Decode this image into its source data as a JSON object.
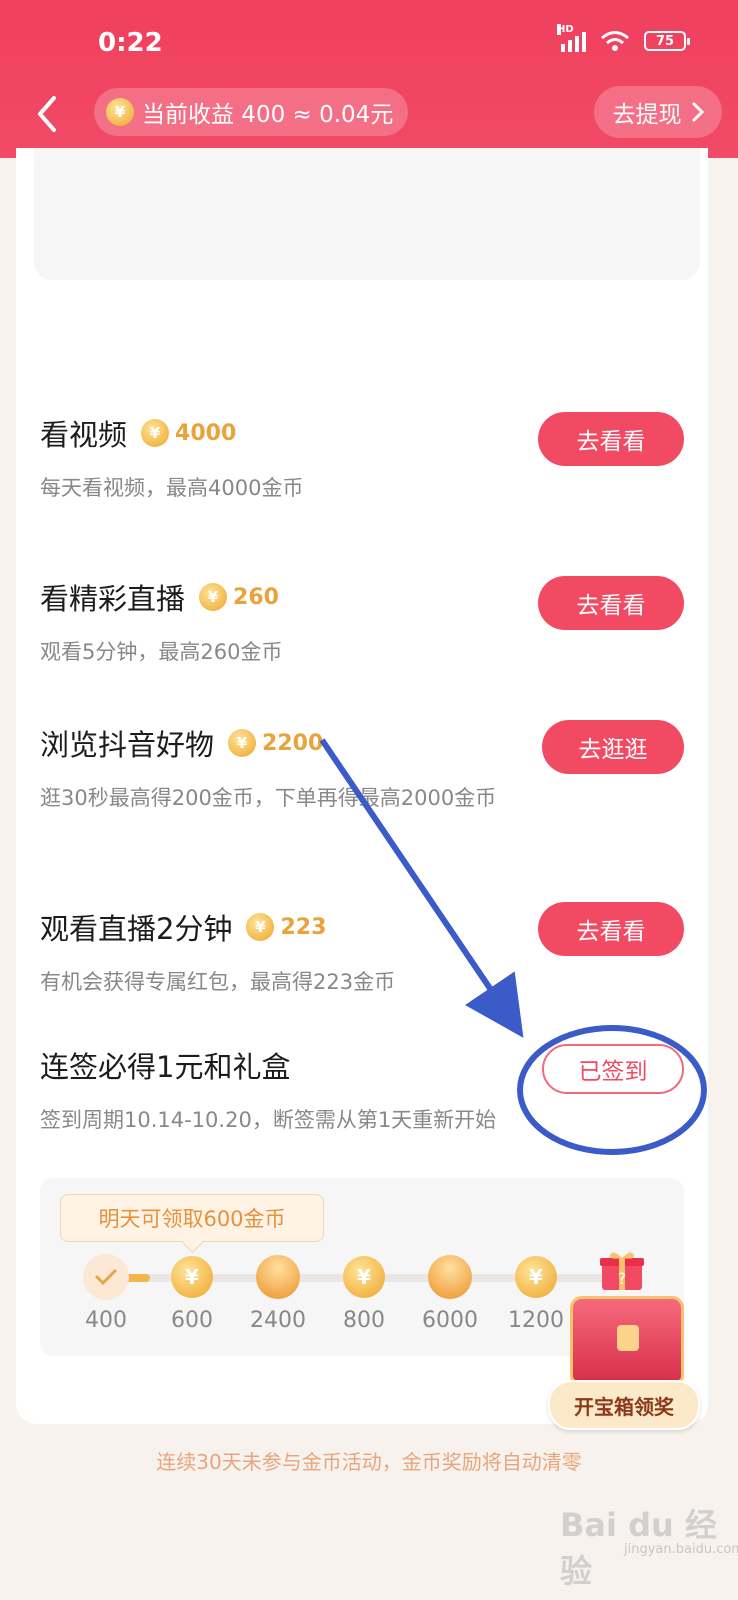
{
  "status_bar": {
    "time": "0:22",
    "network": "HD",
    "battery": "75"
  },
  "header": {
    "earnings": "当前收益 400 ≈ 0.04元",
    "withdraw": "去提现",
    "coin_glyph": "¥"
  },
  "tasks": [
    {
      "title": "看视频",
      "reward": "4000",
      "desc": "每天看视频，最高4000金币",
      "button": "去看看"
    },
    {
      "title": "看精彩直播",
      "reward": "260",
      "desc": "观看5分钟，最高260金币",
      "button": "去看看"
    },
    {
      "title": "浏览抖音好物",
      "reward": "2200",
      "desc": "逛30秒最高得200金币，下单再得最高2000金币",
      "button": "去逛逛"
    },
    {
      "title": "观看直播2分钟",
      "reward": "223",
      "desc": "有机会获得专属红包，最高得223金币",
      "button": "去看看"
    },
    {
      "title": "连签必得1元和礼盒",
      "desc": "签到周期10.14-10.20，断签需从第1天重新开始",
      "button": "已签到"
    }
  ],
  "signin": {
    "tip": "明天可领取600金币",
    "days": [
      "400",
      "600",
      "2400",
      "800",
      "6000",
      "1200"
    ],
    "chest_label": "开宝箱领奖",
    "gift_mark": "?"
  },
  "footer": {
    "note": "连续30天未参与金币活动，金币奖励将自动清零"
  },
  "watermark": {
    "brand": "Bai du 经验",
    "url": "jingyan.baidu.com"
  },
  "colors": {
    "brand_red": "#f24a63",
    "coin_gold": "#f3b74a",
    "annotation_blue": "#3b5bc9"
  }
}
